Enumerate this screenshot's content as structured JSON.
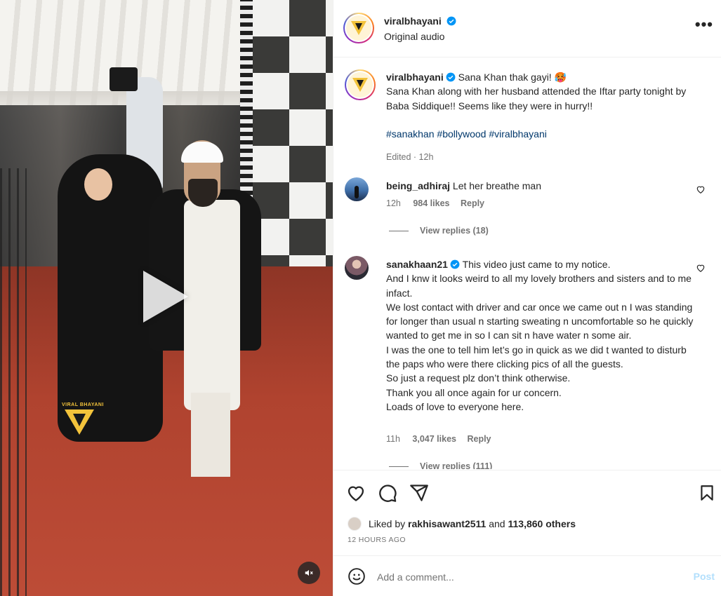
{
  "colors": {
    "accent": "#0095f6",
    "link": "#00376b",
    "muted": "#737373",
    "post_disabled": "#b2dffc"
  },
  "video": {
    "watermark": "VIRAL BHAYANI",
    "play_icon": "play-icon",
    "mute_icon": "speaker-muted-icon"
  },
  "header": {
    "username": "viralbhayani",
    "subtitle": "Original audio",
    "more_icon": "more-horizontal-icon"
  },
  "caption": {
    "username": "viralbhayani",
    "text_line1": " Sana Khan thak gayi! 🥵",
    "text_body": "Sana Khan along with her husband attended the Iftar party tonight by Baba Siddique!! Seems like they were in hurry!!",
    "hashtags": [
      "#sanakhan",
      "#bollywood",
      "#viralbhayani"
    ],
    "meta": "Edited · 12h"
  },
  "comments": [
    {
      "username": "being_adhiraj",
      "text": "Let her breathe man",
      "time": "12h",
      "likes": "984 likes",
      "reply_label": "Reply",
      "view_replies": "View replies (18)"
    },
    {
      "username": "sanakhaan21",
      "verified": true,
      "text_first": "This video just came to my notice.",
      "text_lines": [
        "And I knw it looks weird to all my lovely brothers and sisters and to me infact.",
        "We lost contact with driver and car once we came out n I was standing for longer than usual n starting sweating n uncomfortable so he quickly wanted to get me in so I can sit n have water n some air.",
        "I was the one to tell him let’s go in quick as we did t wanted to disturb the paps who were there clicking pics of all the guests.",
        "So just a request plz don’t think otherwise.",
        "Thank you all once again for ur concern.",
        "Loads of love to everyone here."
      ],
      "time": "11h",
      "likes": "3,047 likes",
      "reply_label": "Reply",
      "view_replies": "View replies (111)"
    }
  ],
  "actions": {
    "like_icon": "heart-icon",
    "comment_icon": "comment-icon",
    "share_icon": "send-icon",
    "save_icon": "bookmark-icon",
    "liked_by_prefix": "Liked by ",
    "liked_by_user": "rakhisawant2511",
    "liked_by_and": " and ",
    "liked_by_others": "113,860 others",
    "timestamp": "12 HOURS AGO"
  },
  "add_comment": {
    "placeholder": "Add a comment...",
    "post_label": "Post",
    "emoji_icon": "emoji-icon"
  }
}
